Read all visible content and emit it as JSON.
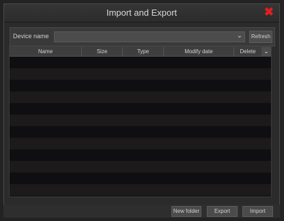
{
  "dialog": {
    "title": "Import and Export",
    "close_icon": "close-icon"
  },
  "device": {
    "label": "Device name",
    "selected_value": "",
    "refresh_label": "Refresh"
  },
  "table": {
    "columns": [
      "Name",
      "Size",
      "Type",
      "Modify date",
      "Delete"
    ],
    "rows": []
  },
  "actions": {
    "new_folder_label": "New folder",
    "export_label": "Export",
    "import_label": "Import"
  },
  "colors": {
    "close": "#e21f1f",
    "background": "#232323",
    "table_bg": "#0b0b0b"
  }
}
